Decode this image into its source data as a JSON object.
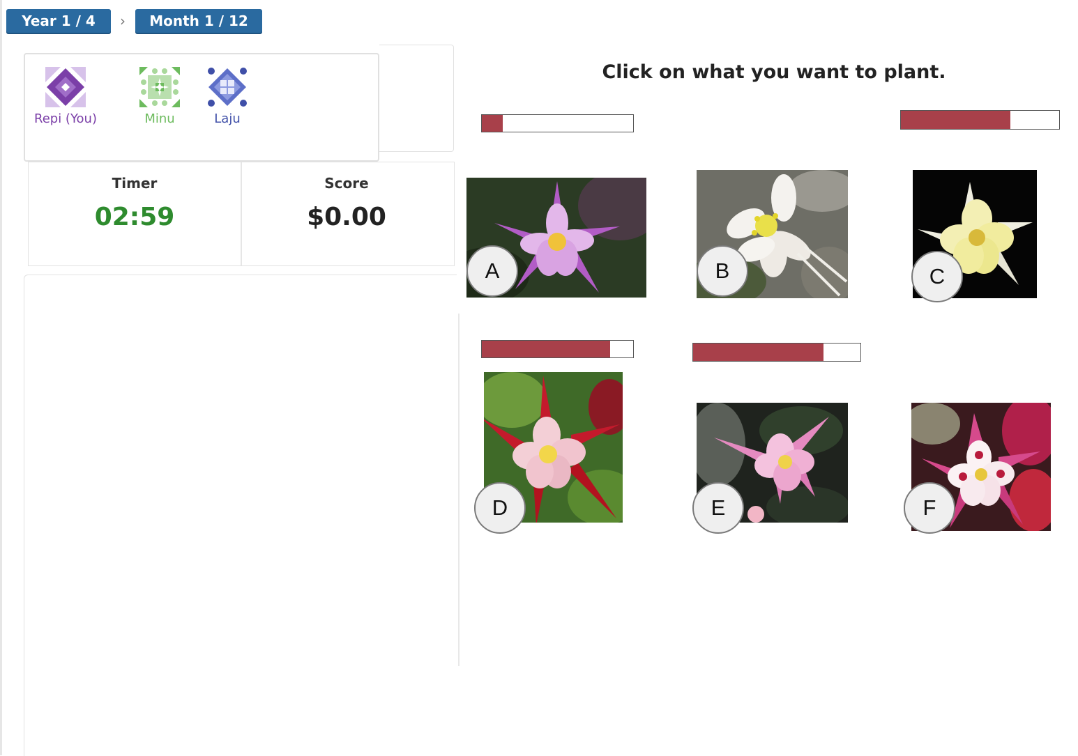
{
  "breadcrumb": {
    "year": "Year 1 / 4",
    "month": "Month 1 / 12",
    "separator": "›"
  },
  "players": [
    {
      "name": "Repi (You)",
      "color": "#7b3fa8",
      "icon": "purple-diamond-emblem-icon"
    },
    {
      "name": "Minu",
      "color": "#6dbb5e",
      "icon": "green-star-emblem-icon"
    },
    {
      "name": "Laju",
      "color": "#3f4fa8",
      "icon": "blue-grid-emblem-icon"
    }
  ],
  "stats": {
    "timer_label": "Timer",
    "timer_value": "02:59",
    "timer_color": "#2e8b2e",
    "score_label": "Score",
    "score_value": "$0.00"
  },
  "main": {
    "instruction": "Click on what you want to plant."
  },
  "colors": {
    "breadcrumb_bg": "#2a6aa0",
    "bar_fill": "#a8404a"
  },
  "flowers": [
    {
      "label": "A",
      "fill_fraction": 0.14,
      "petal_color": "#c98ad8",
      "background": "dark-green"
    },
    {
      "label": "B",
      "fill_fraction": null,
      "petal_color": "#f4f2ee",
      "background": "grey-rocks"
    },
    {
      "label": "C",
      "fill_fraction": 0.69,
      "petal_color": "#f3efb4",
      "background": "black"
    },
    {
      "label": "D",
      "fill_fraction": 0.85,
      "petal_color": "#c41a2c",
      "background": "green-leaves"
    },
    {
      "label": "E",
      "fill_fraction": 0.78,
      "petal_color": "#ec9ac8",
      "background": "dark-grey"
    },
    {
      "label": "F",
      "fill_fraction": null,
      "petal_color": "#d64a8c",
      "background": "red-flowers"
    }
  ]
}
